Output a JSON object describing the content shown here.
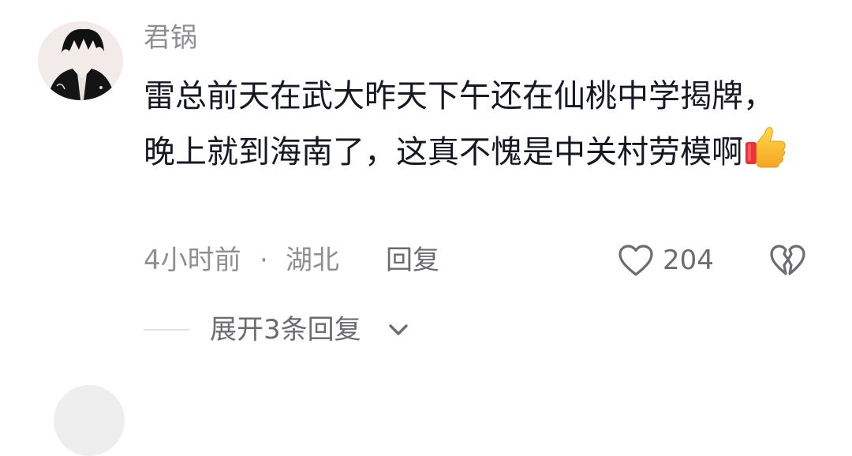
{
  "comment": {
    "username": "君锅",
    "text": "雷总前天在武大昨天下午还在仙桃中学揭牌，晚上就到海南了，这真不愧是中关村劳模啊",
    "emoji": "thumbs-up-emoji",
    "time": "4小时前",
    "separator": "·",
    "location": "湖北",
    "reply_label": "回复",
    "like_count": "204",
    "expand_label": "展开3条回复",
    "icons": {
      "like": "heart-outline-icon",
      "dislike": "broken-heart-icon",
      "expand": "chevron-down-icon"
    }
  },
  "colors": {
    "text_primary": "#161823",
    "text_secondary": "#8f8f93",
    "text_action": "#6b6b70",
    "divider": "#e3e3e6"
  }
}
